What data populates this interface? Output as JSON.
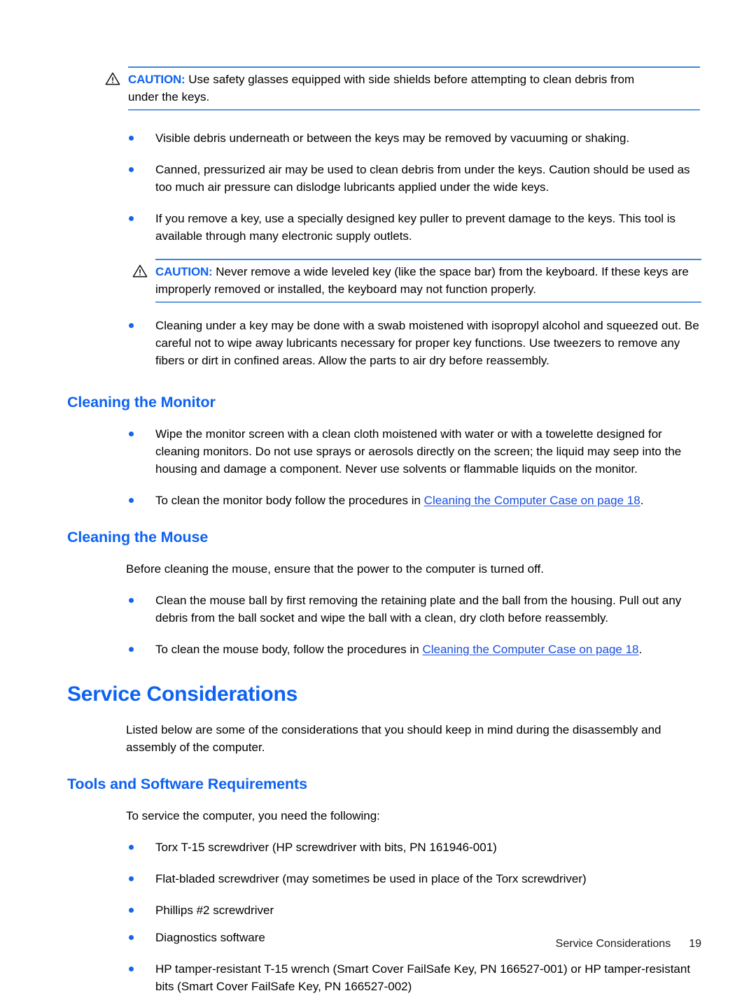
{
  "document": {
    "page_number": "19",
    "footer_title": "Service Considerations"
  },
  "caution_1": {
    "icon": "warning-triangle-icon",
    "label": "CAUTION:",
    "text": "Use safety glasses equipped with side shields before attempting to clean debris from under the keys."
  },
  "keyboard_bullets": [
    "Visible debris underneath or between the keys may be removed by vacuuming or shaking.",
    "Canned, pressurized air may be used to clean debris from under the keys. Caution should be used as too much air pressure can dislodge lubricants applied under the wide keys.",
    "If you remove a key, use a specially designed key puller to prevent damage to the keys. This tool is available through many electronic supply outlets."
  ],
  "caution_2": {
    "icon": "warning-triangle-icon",
    "label": "CAUTION:",
    "text": "Never remove a wide leveled key (like the space bar) from the keyboard. If these keys are improperly removed or installed, the keyboard may not function properly."
  },
  "keyboard_bullets_after": [
    "Cleaning under a key may be done with a swab moistened with isopropyl alcohol and squeezed out. Be careful not to wipe away lubricants necessary for proper key functions. Use tweezers to remove any fibers or dirt in confined areas. Allow the parts to air dry before reassembly."
  ],
  "monitor_section": {
    "heading": "Cleaning the Monitor",
    "bullet_1": "Wipe the monitor screen with a clean cloth moistened with water or with a towelette designed for cleaning monitors. Do not use sprays or aerosols directly on the screen; the liquid may seep into the housing and damage a component. Never use solvents or flammable liquids on the monitor.",
    "bullet_2_prefix": "To clean the monitor body follow the procedures in ",
    "bullet_2_link": "Cleaning the Computer Case on page 18",
    "bullet_2_suffix": "."
  },
  "mouse_section": {
    "heading": "Cleaning the Mouse",
    "intro": "Before cleaning the mouse, ensure that the power to the computer is turned off.",
    "bullet_1": "Clean the mouse ball by first removing the retaining plate and the ball from the housing. Pull out any debris from the ball socket and wipe the ball with a clean, dry cloth before reassembly.",
    "bullet_2_prefix": "To clean the mouse body, follow the procedures in ",
    "bullet_2_link": "Cleaning the Computer Case on page 18",
    "bullet_2_suffix": "."
  },
  "service_section": {
    "heading": "Service Considerations",
    "intro": "Listed below are some of the considerations that you should keep in mind during the disassembly and assembly of the computer."
  },
  "tools_section": {
    "heading": "Tools and Software Requirements",
    "intro": "To service the computer, you need the following:",
    "items": [
      "Torx T-15 screwdriver (HP screwdriver with bits, PN 161946-001)",
      "Flat-bladed screwdriver (may sometimes be used in place of the Torx screwdriver)",
      "Phillips #2 screwdriver",
      "Diagnostics software",
      "HP tamper-resistant T-15 wrench (Smart Cover FailSafe Key, PN 166527-001) or HP tamper-resistant bits (Smart Cover FailSafe Key, PN 166527-002)"
    ]
  },
  "colors": {
    "heading_blue": "#0d62f2",
    "link_blue": "#1a4fe0",
    "bullet_blue": "#1565e8",
    "rule_blue": "#4b8fe0"
  }
}
